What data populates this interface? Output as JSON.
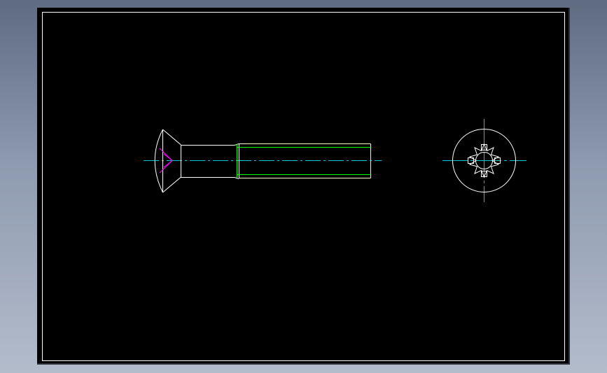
{
  "colors": {
    "background_top": "#5f6b81",
    "background_bottom": "#b3bccb",
    "model_space": "#000000",
    "frame": "#ffffff",
    "outline": "#ffffff",
    "thread": "#00ff00",
    "thread_end": "#ffff66",
    "center_line": "#00c8d2",
    "recess_side": "#ff00ff"
  },
  "views": {
    "side": "side-view-countersunk-screw",
    "end": "end-view-pozidriv-recess"
  }
}
